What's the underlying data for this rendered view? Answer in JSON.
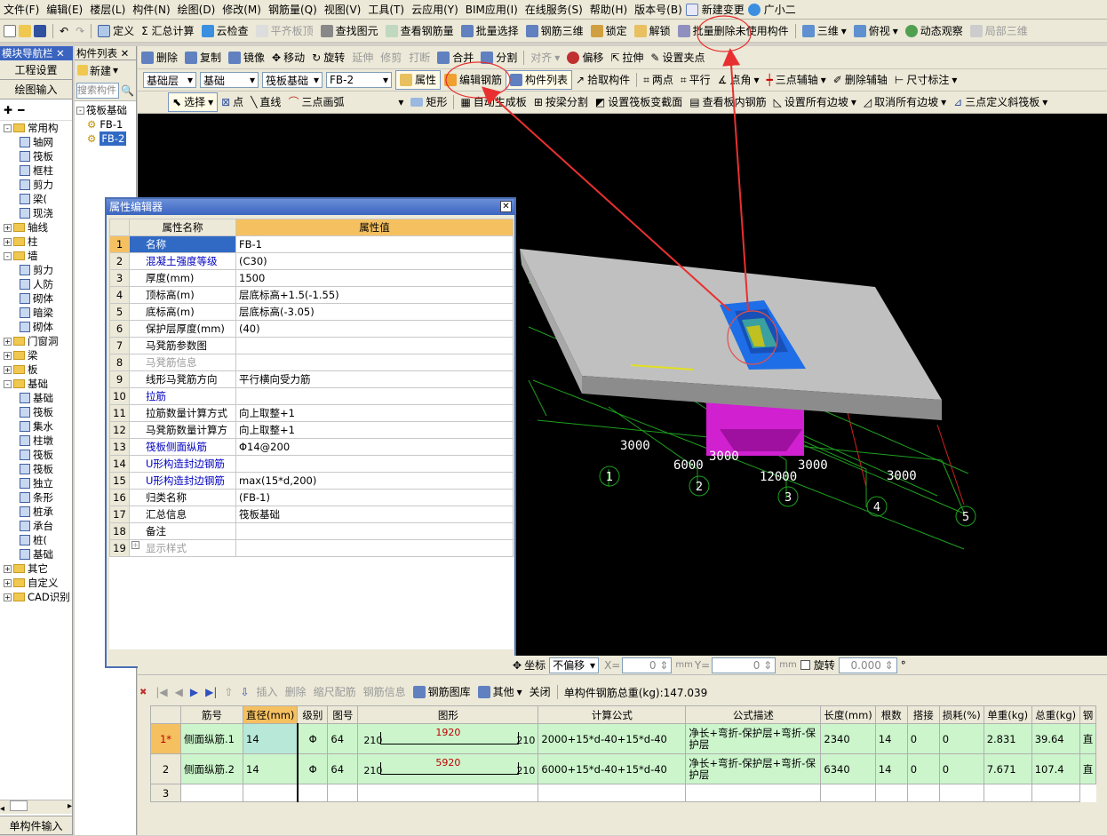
{
  "menu": [
    "文件(F)",
    "编辑(E)",
    "楼层(L)",
    "构件(N)",
    "绘图(D)",
    "修改(M)",
    "钢筋量(Q)",
    "视图(V)",
    "工具(T)",
    "云应用(Y)",
    "BIM应用(I)",
    "在线服务(S)",
    "帮助(H)",
    "版本号(B)",
    "新建变更",
    "广小二"
  ],
  "toolbar1": [
    "定义",
    "Σ 汇总计算",
    "云检查",
    "平齐板顶",
    "查找图元",
    "查看钢筋量",
    "批量选择",
    "钢筋三维",
    "锁定",
    "解锁",
    "批量删除未使用构件",
    "三维",
    "俯视",
    "动态观察",
    "局部三维"
  ],
  "toolbar2": [
    "删除",
    "复制",
    "镜像",
    "移动",
    "旋转",
    "延伸",
    "修剪",
    "打断",
    "合并",
    "分割",
    "对齐",
    "偏移",
    "拉伸",
    "设置夹点"
  ],
  "toolbar3": {
    "floor": "基础层",
    "category": "基础",
    "type": "筏板基础",
    "component": "FB-2",
    "buttons": [
      "属性",
      "编辑钢筋",
      "构件列表",
      "拾取构件",
      "两点",
      "平行",
      "点角",
      "三点辅轴",
      "删除辅轴",
      "尺寸标注"
    ]
  },
  "toolbar4": [
    "选择",
    "点",
    "直线",
    "三点画弧",
    "矩形",
    "自动生成板",
    "按梁分割",
    "设置筏板变截面",
    "查看板内钢筋",
    "设置所有边坡",
    "取消所有边坡",
    "三点定义斜筏板"
  ],
  "leftnav": {
    "tab": "模块导航栏",
    "buttons": [
      "工程设置",
      "绘图输入"
    ],
    "tree": [
      {
        "l": 0,
        "t": "常用构",
        "pm": "-",
        "k": "f"
      },
      {
        "l": 1,
        "t": "轴网",
        "k": "i"
      },
      {
        "l": 1,
        "t": "筏板",
        "k": "i"
      },
      {
        "l": 1,
        "t": "框柱",
        "k": "i"
      },
      {
        "l": 1,
        "t": "剪力",
        "k": "i"
      },
      {
        "l": 1,
        "t": "梁(",
        "k": "i"
      },
      {
        "l": 1,
        "t": "现浇",
        "k": "i"
      },
      {
        "l": 0,
        "t": "轴线",
        "pm": "+",
        "k": "f"
      },
      {
        "l": 0,
        "t": "柱",
        "pm": "+",
        "k": "f"
      },
      {
        "l": 0,
        "t": "墙",
        "pm": "-",
        "k": "f"
      },
      {
        "l": 1,
        "t": "剪力",
        "k": "i"
      },
      {
        "l": 1,
        "t": "人防",
        "k": "i"
      },
      {
        "l": 1,
        "t": "砌体",
        "k": "i"
      },
      {
        "l": 1,
        "t": "暗梁",
        "k": "i"
      },
      {
        "l": 1,
        "t": "砌体",
        "k": "i"
      },
      {
        "l": 0,
        "t": "门窗洞",
        "pm": "+",
        "k": "f"
      },
      {
        "l": 0,
        "t": "梁",
        "pm": "+",
        "k": "f"
      },
      {
        "l": 0,
        "t": "板",
        "pm": "+",
        "k": "f"
      },
      {
        "l": 0,
        "t": "基础",
        "pm": "-",
        "k": "f"
      },
      {
        "l": 1,
        "t": "基础",
        "k": "i"
      },
      {
        "l": 1,
        "t": "筏板",
        "k": "i"
      },
      {
        "l": 1,
        "t": "集水",
        "k": "i"
      },
      {
        "l": 1,
        "t": "柱墩",
        "k": "i"
      },
      {
        "l": 1,
        "t": "筏板",
        "k": "i"
      },
      {
        "l": 1,
        "t": "筏板",
        "k": "i"
      },
      {
        "l": 1,
        "t": "独立",
        "k": "i"
      },
      {
        "l": 1,
        "t": "条形",
        "k": "i"
      },
      {
        "l": 1,
        "t": "桩承",
        "k": "i"
      },
      {
        "l": 1,
        "t": "承台",
        "k": "i"
      },
      {
        "l": 1,
        "t": "桩(",
        "k": "i"
      },
      {
        "l": 1,
        "t": "基础",
        "k": "i"
      },
      {
        "l": 0,
        "t": "其它",
        "pm": "+",
        "k": "f"
      },
      {
        "l": 0,
        "t": "自定义",
        "pm": "+",
        "k": "f"
      },
      {
        "l": 0,
        "t": "CAD识别",
        "pm": "+",
        "k": "f"
      }
    ],
    "footer": "单构件输入"
  },
  "complist": {
    "tab": "构件列表",
    "new": "新建",
    "search": "搜索构件",
    "root": "筏板基础",
    "items": [
      "FB-1",
      "FB-2"
    ]
  },
  "viewport": {
    "dims": [
      "3000",
      "6000",
      "3000",
      "12000",
      "3000",
      "3000"
    ],
    "axes": [
      "1",
      "2",
      "3",
      "4",
      "5"
    ]
  },
  "propeditor": {
    "title": "属性编辑器",
    "headers": [
      "属性名称",
      "属性值"
    ],
    "rows": [
      {
        "n": "1",
        "name": "名称",
        "val": "FB-1",
        "c": ""
      },
      {
        "n": "2",
        "name": "混凝土强度等级",
        "val": "(C30)",
        "c": "blue"
      },
      {
        "n": "3",
        "name": "厚度(mm)",
        "val": "1500",
        "c": ""
      },
      {
        "n": "4",
        "name": "顶标高(m)",
        "val": "层底标高+1.5(-1.55)",
        "c": ""
      },
      {
        "n": "5",
        "name": "底标高(m)",
        "val": "层底标高(-3.05)",
        "c": ""
      },
      {
        "n": "6",
        "name": "保护层厚度(mm)",
        "val": "(40)",
        "c": ""
      },
      {
        "n": "7",
        "name": "马凳筋参数图",
        "val": "",
        "c": ""
      },
      {
        "n": "8",
        "name": "马凳筋信息",
        "val": "",
        "c": "gray"
      },
      {
        "n": "9",
        "name": "线形马凳筋方向",
        "val": "平行横向受力筋",
        "c": ""
      },
      {
        "n": "10",
        "name": "拉筋",
        "val": "",
        "c": "blue"
      },
      {
        "n": "11",
        "name": "拉筋数量计算方式",
        "val": "向上取整+1",
        "c": ""
      },
      {
        "n": "12",
        "name": "马凳筋数量计算方",
        "val": "向上取整+1",
        "c": ""
      },
      {
        "n": "13",
        "name": "筏板侧面纵筋",
        "val": "Φ14@200",
        "c": "blue"
      },
      {
        "n": "14",
        "name": "U形构造封边钢筋",
        "val": "",
        "c": "blue"
      },
      {
        "n": "15",
        "name": "U形构造封边钢筋",
        "val": "max(15*d,200)",
        "c": "blue"
      },
      {
        "n": "16",
        "name": "归类名称",
        "val": "(FB-1)",
        "c": ""
      },
      {
        "n": "17",
        "name": "汇总信息",
        "val": "筏板基础",
        "c": ""
      },
      {
        "n": "18",
        "name": "备注",
        "val": "",
        "c": ""
      },
      {
        "n": "19",
        "name": "显示样式",
        "val": "",
        "c": "gray"
      }
    ]
  },
  "coordbar": {
    "coord": "坐标",
    "mode": "不偏移",
    "x": "0",
    "y": "0",
    "unit": "mm",
    "rotate": "旋转",
    "angle": "0.000"
  },
  "rebar": {
    "toolbar": [
      "插入",
      "删除",
      "缩尺配筋",
      "钢筋信息",
      "钢筋图库",
      "其他",
      "关闭"
    ],
    "total": "单构件钢筋总重(kg):147.039",
    "headers": [
      "筋号",
      "直径(mm)",
      "级别",
      "图号",
      "图形",
      "计算公式",
      "公式描述",
      "长度(mm)",
      "根数",
      "搭接",
      "损耗(%)",
      "单重(kg)",
      "总重(kg)",
      "钢"
    ],
    "rows": [
      {
        "idx": "1*",
        "name": "侧面纵筋.1",
        "dia": "14",
        "grade": "Φ",
        "fig": "64",
        "l": "210",
        "v": "1920",
        "r": "210",
        "formula": "2000+15*d-40+15*d-40",
        "desc": "净长+弯折-保护层+弯折-保护层",
        "len": "2340",
        "cnt": "14",
        "lap": "0",
        "loss": "0",
        "uw": "2.831",
        "tw": "39.64",
        "x": "直"
      },
      {
        "idx": "2",
        "name": "侧面纵筋.2",
        "dia": "14",
        "grade": "Φ",
        "fig": "64",
        "l": "210",
        "v": "5920",
        "r": "210",
        "formula": "6000+15*d-40+15*d-40",
        "desc": "净长+弯折-保护层+弯折-保护层",
        "len": "6340",
        "cnt": "14",
        "lap": "0",
        "loss": "0",
        "uw": "7.671",
        "tw": "107.4",
        "x": "直"
      }
    ],
    "empty": "3"
  }
}
